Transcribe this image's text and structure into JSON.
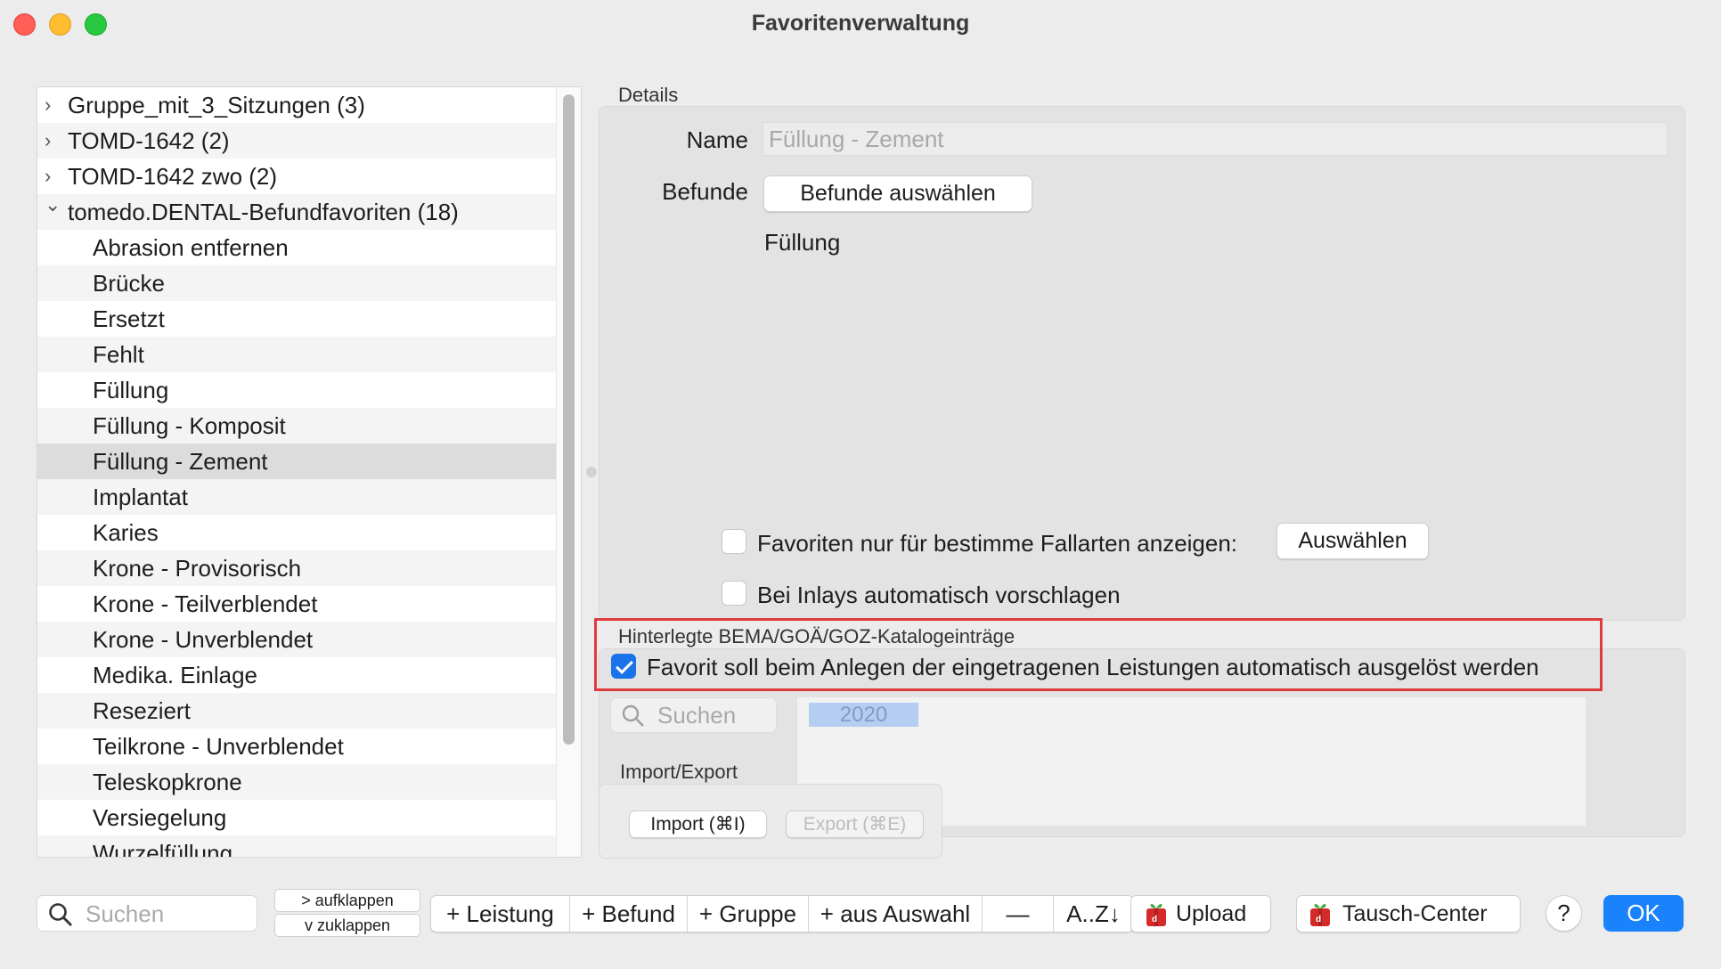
{
  "window": {
    "title": "Favoritenverwaltung"
  },
  "tree": {
    "groups": [
      {
        "label": "Gruppe_mit_3_Sitzungen (3)",
        "expanded": false
      },
      {
        "label": "TOMD-1642 (2)",
        "expanded": false
      },
      {
        "label": "TOMD-1642 zwo (2)",
        "expanded": false
      },
      {
        "label": "tomedo.DENTAL-Befundfavoriten (18)",
        "expanded": true
      }
    ],
    "children": [
      "Abrasion entfernen",
      "Brücke",
      "Ersetzt",
      "Fehlt",
      "Füllung",
      "Füllung - Komposit",
      "Füllung - Zement",
      "Implantat",
      "Karies",
      "Krone - Provisorisch",
      "Krone - Teilverblendet",
      "Krone - Unverblendet",
      "Medika. Einlage",
      "Reseziert",
      "Teilkrone - Unverblendet",
      "Teleskopkrone",
      "Versiegelung",
      "Wurzelfüllung"
    ],
    "selected": "Füllung - Zement",
    "chevron_collapsed": "›",
    "chevron_expanded": "⌄"
  },
  "details": {
    "section_label": "Details",
    "name_label": "Name",
    "name_placeholder": "Füllung - Zement",
    "befunde_label": "Befunde",
    "befunde_button": "Befunde auswählen",
    "befunde_value": "Füllung",
    "fallarten_checkbox": {
      "label": "Favoriten nur für bestimme Fallarten anzeigen:",
      "checked": false
    },
    "fallarten_button": "Auswählen",
    "inlays_checkbox": {
      "label": "Bei Inlays automatisch vorschlagen",
      "checked": false
    }
  },
  "katalog": {
    "section_label": "Hinterlegte BEMA/GOÄ/GOZ-Katalogeinträge",
    "auto_checkbox": {
      "label": "Favorit soll beim Anlegen der eingetragenen Leistungen automatisch ausgelöst werden",
      "checked": true
    },
    "search_placeholder": "Suchen",
    "year_tag": "2020"
  },
  "import_export": {
    "section_label": "Import/Export",
    "import_button": "Import (⌘I)",
    "export_button": "Export (⌘E)"
  },
  "bottom_bar": {
    "search_placeholder": "Suchen",
    "expand_label": "> aufklappen",
    "collapse_label": "v  zuklappen",
    "add_leistung": "+ Leistung",
    "add_befund": "+ Befund",
    "add_gruppe": "+ Gruppe",
    "add_aus_auswahl": "+ aus Auswahl",
    "remove": "—",
    "sort": "A..Z↓",
    "upload": "Upload",
    "tausch_center": "Tausch-Center",
    "help": "?",
    "ok": "OK"
  },
  "colors": {
    "accent": "#1a82fb",
    "highlight_border": "#e03a3e",
    "checkbox_checked": "#1a73e8"
  }
}
